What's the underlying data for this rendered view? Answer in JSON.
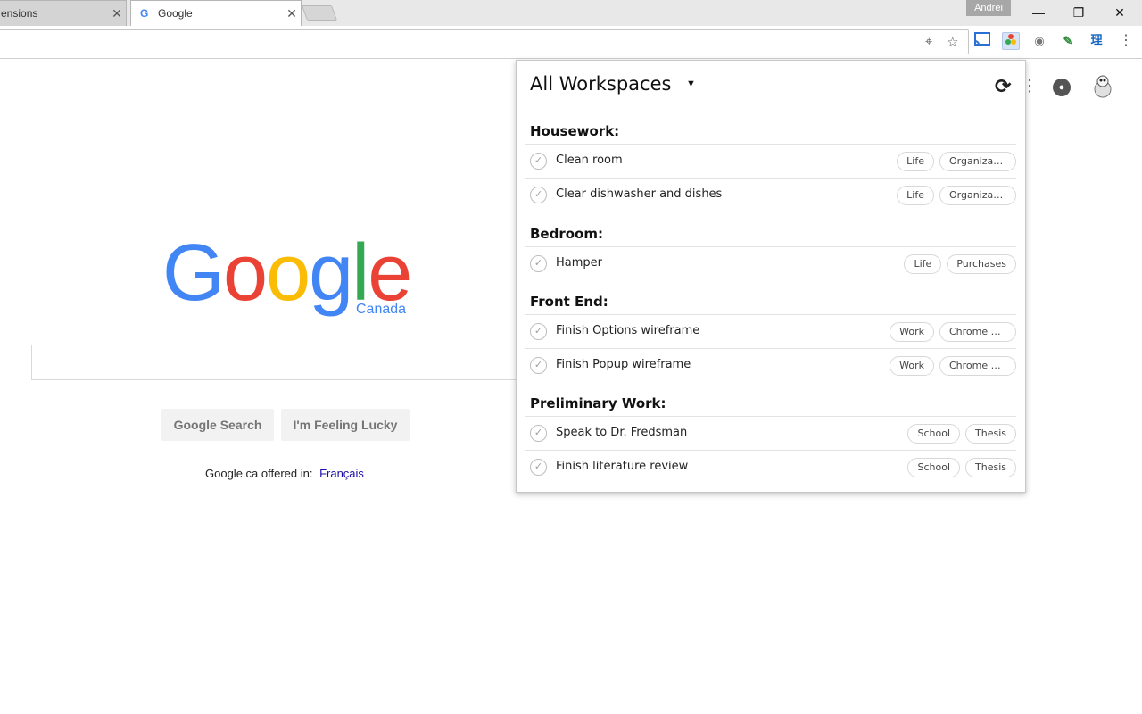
{
  "browser": {
    "tabs": [
      {
        "title": "ensions",
        "active": false
      },
      {
        "title": "Google",
        "active": true
      }
    ],
    "profile_name": "Andrei",
    "window_controls": {
      "minimize": "—",
      "restore": "❐",
      "close": "✕"
    },
    "tab_close_glyph": "✕"
  },
  "google_page": {
    "logo_letters": [
      {
        "char": "G",
        "color": "#4285F4"
      },
      {
        "char": "o",
        "color": "#EA4335"
      },
      {
        "char": "o",
        "color": "#FBBC05"
      },
      {
        "char": "g",
        "color": "#4285F4"
      },
      {
        "char": "l",
        "color": "#34A853"
      },
      {
        "char": "e",
        "color": "#EA4335"
      }
    ],
    "country": "Canada",
    "search_button": "Google Search",
    "lucky_button": "I'm Feeling Lucky",
    "offered_text": "Google.ca offered in:",
    "offered_link": "Français"
  },
  "popup": {
    "workspace": "All Workspaces",
    "groups": [
      {
        "name": "Housework:",
        "tasks": [
          {
            "title": "Clean room",
            "tags": [
              "Life",
              "Organizat..."
            ]
          },
          {
            "title": "Clear dishwasher and dishes",
            "tags": [
              "Life",
              "Organizat..."
            ]
          }
        ]
      },
      {
        "name": "Bedroom:",
        "tasks": [
          {
            "title": "Hamper",
            "tags": [
              "Life",
              "Purchases"
            ]
          }
        ]
      },
      {
        "name": "Front End:",
        "tasks": [
          {
            "title": "Finish Options wireframe",
            "tags": [
              "Work",
              "Chrome E..."
            ]
          },
          {
            "title": "Finish Popup wireframe",
            "tags": [
              "Work",
              "Chrome E..."
            ]
          }
        ]
      },
      {
        "name": "Preliminary Work:",
        "tasks": [
          {
            "title": "Speak to Dr. Fredsman",
            "tags": [
              "School",
              "Thesis"
            ]
          },
          {
            "title": "Finish literature review",
            "tags": [
              "School",
              "Thesis"
            ]
          }
        ]
      }
    ]
  },
  "icons": {
    "location": "location-icon",
    "bookmark": "star-icon",
    "cast": "cast-icon",
    "menu": "more-vert-icon",
    "refresh": "refresh-icon",
    "notifications": "bell-icon"
  },
  "colors": {
    "accent_blue": "#4285F4",
    "link": "#1a0dab"
  }
}
